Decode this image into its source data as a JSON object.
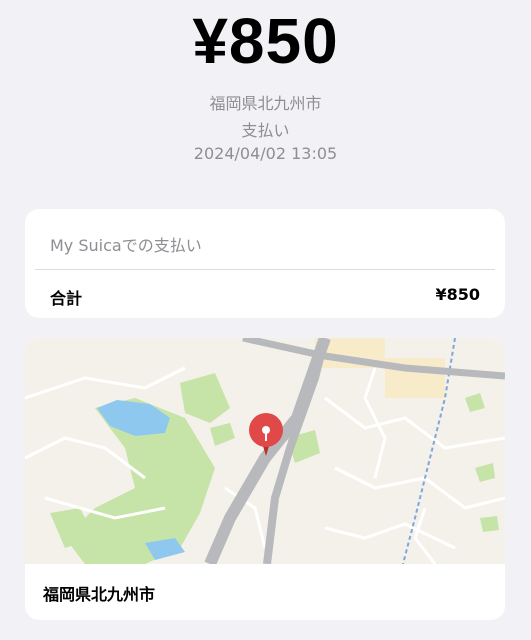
{
  "receipt": {
    "amount": "¥850",
    "location": "福岡県北九州市",
    "type": "支払い",
    "datetime": "2024/04/02 13:05"
  },
  "summary_card": {
    "label": "My Suicaでの支払い",
    "total_label": "合計",
    "total_value": "¥850"
  },
  "map_card": {
    "place": "福岡県北九州市",
    "pin_icon": "map-pin-icon",
    "colors": {
      "land": "#f3f1ea",
      "park": "#c6e3a8",
      "water": "#8ec8ef",
      "highway": "#b7b9bd",
      "pin": "#e14848"
    }
  }
}
